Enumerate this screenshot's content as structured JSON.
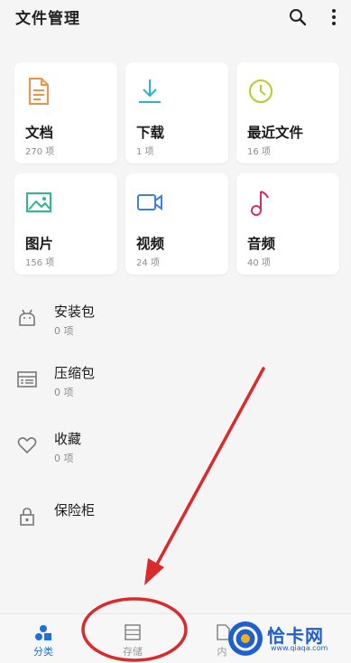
{
  "header": {
    "title": "文件管理",
    "icons": [
      "search-icon",
      "more-vert-icon"
    ]
  },
  "categories": [
    {
      "name": "文档",
      "count": "270 项",
      "icon": "document-icon",
      "color": "#f0914a"
    },
    {
      "name": "下载",
      "count": "1 项",
      "icon": "download-icon",
      "color": "#29b3d6"
    },
    {
      "name": "最近文件",
      "count": "16 项",
      "icon": "clock-icon",
      "color": "#b5cc2a"
    },
    {
      "name": "图片",
      "count": "156 项",
      "icon": "image-icon",
      "color": "#2fb58f"
    },
    {
      "name": "视频",
      "count": "24 项",
      "icon": "video-icon",
      "color": "#3f7fe0"
    },
    {
      "name": "音频",
      "count": "40 项",
      "icon": "music-icon",
      "color": "#d42e6a"
    }
  ],
  "list": [
    {
      "name": "安装包",
      "count": "0 项",
      "icon": "android-icon"
    },
    {
      "name": "压缩包",
      "count": "0 项",
      "icon": "archive-icon"
    },
    {
      "name": "收藏",
      "count": "0 项",
      "icon": "heart-icon"
    },
    {
      "name": "保险柜",
      "icon": "lock-icon"
    }
  ],
  "bottom_nav": [
    {
      "label": "分类",
      "icon": "category-icon",
      "active": true
    },
    {
      "label": "存储",
      "icon": "storage-icon",
      "active": false
    },
    {
      "label": "内",
      "icon": "folder-icon",
      "active": false
    }
  ],
  "watermark": {
    "text": "恰卡网",
    "sub": "www.qiaqa.com"
  },
  "colors": {
    "accent": "#1f6fd6",
    "annotation": "#d92b2b",
    "background": "#f5f5f5"
  }
}
